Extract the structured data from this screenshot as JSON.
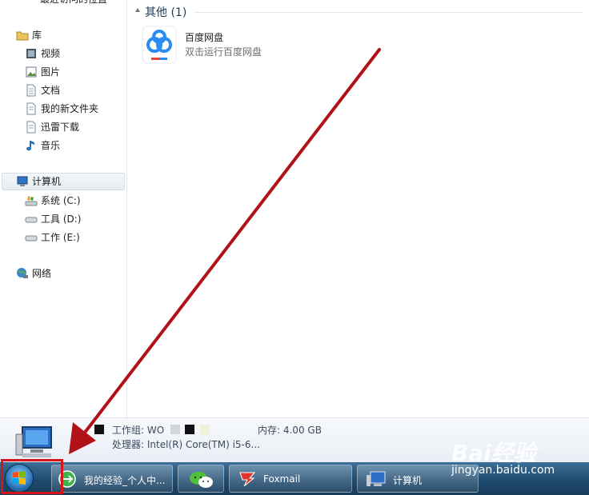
{
  "nav": {
    "top_cut": "最近访问的位置",
    "libraries": "库",
    "videos": "视频",
    "pictures": "图片",
    "documents": "文档",
    "new_folder": "我的新文件夹",
    "thunder": "迅雷下载",
    "music": "音乐",
    "computer": "计算机",
    "drive_c": "系统 (C:)",
    "drive_d": "工具 (D:)",
    "drive_e": "工作 (E:)",
    "network": "网络"
  },
  "main": {
    "group_title": "其他 (1)",
    "app_name": "百度网盘",
    "app_desc": "双击运行百度网盘"
  },
  "details": {
    "workgroup": "工作组: WO",
    "memory": "内存: 4.00 GB",
    "processor": "处理器: Intel(R) Core(TM) i5-6..."
  },
  "taskbar": {
    "browser": "我的经验_个人中...",
    "foxmail": "Foxmail",
    "computer": "计算机"
  },
  "watermark": {
    "logo": "Bai经验",
    "url": "jingyan.baidu.com"
  },
  "colors": {
    "annotation_red": "#b01217",
    "highlight_red": "#d61419"
  }
}
